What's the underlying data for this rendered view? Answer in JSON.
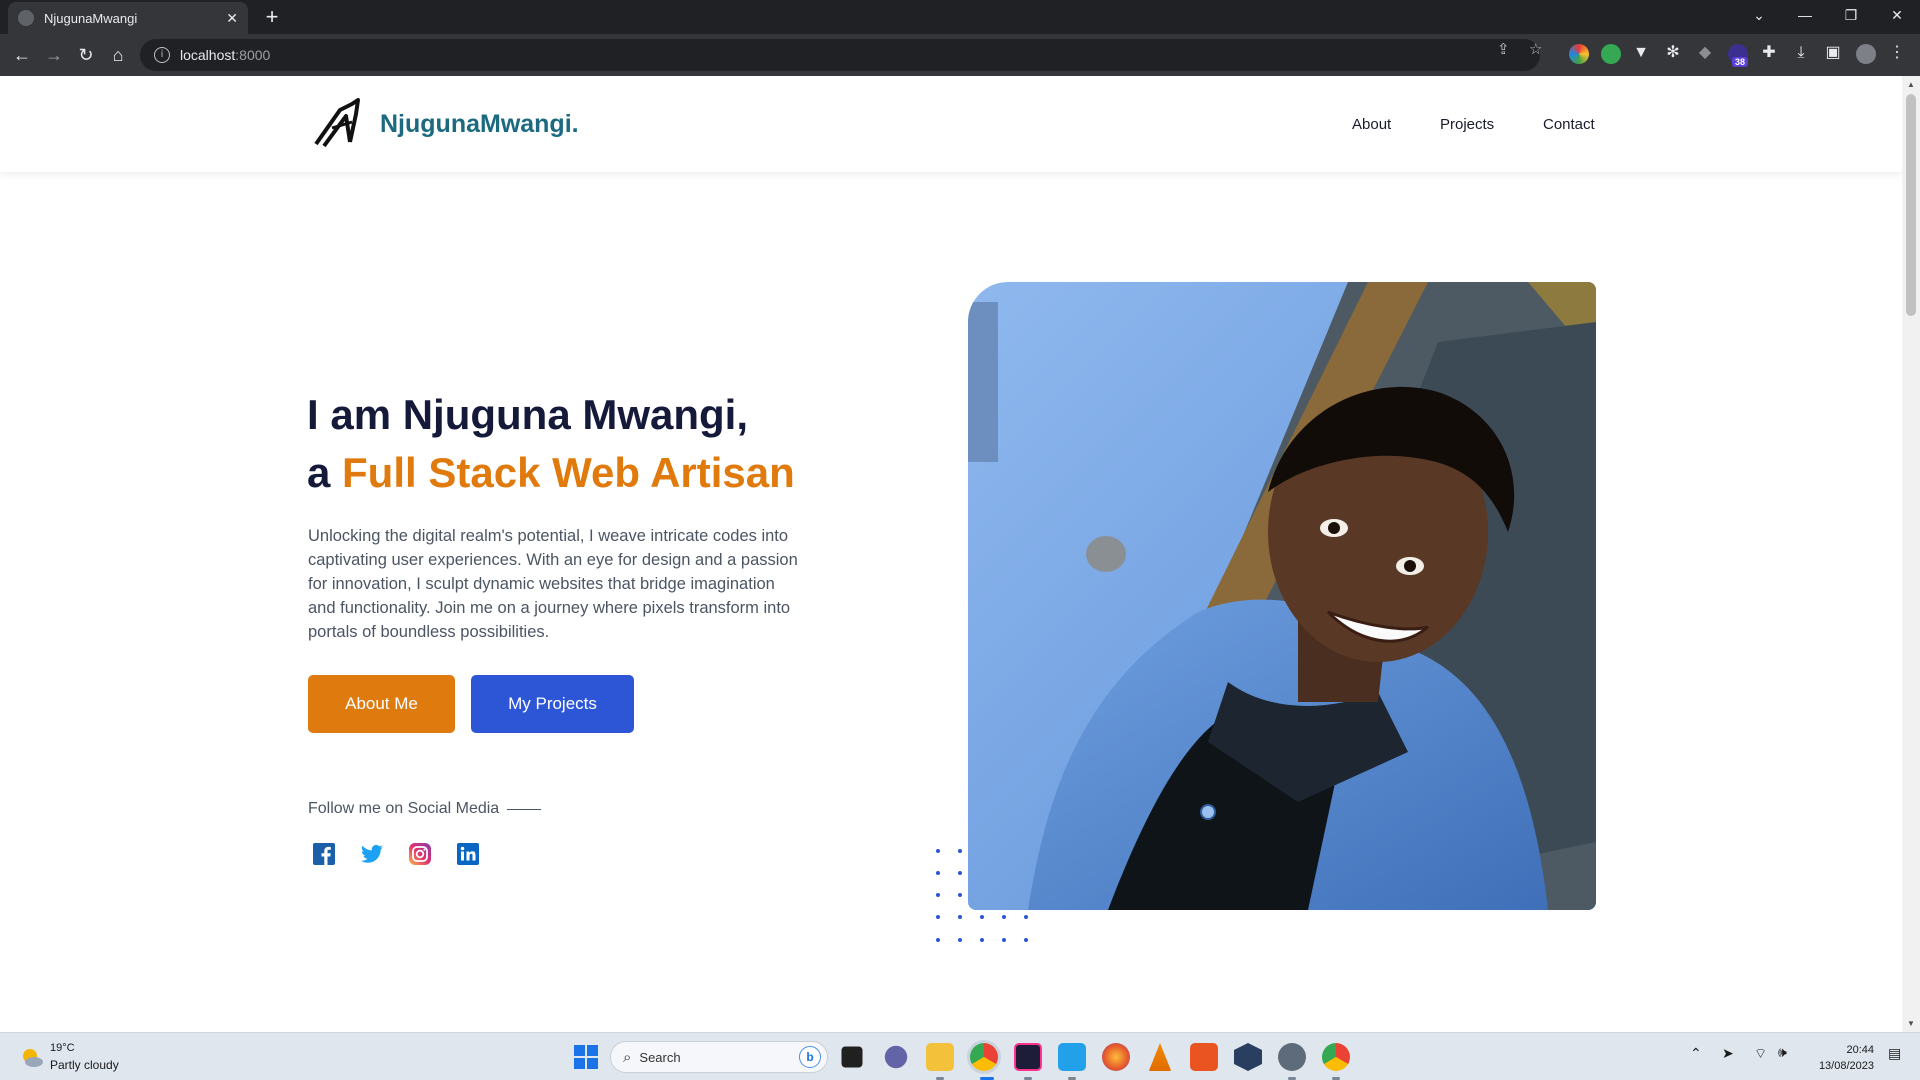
{
  "browser": {
    "tab_title": "NjugunaMwangi",
    "url_host": "localhost",
    "url_port": ":8000",
    "extension_badge": "38"
  },
  "site": {
    "brand": "NjugunaMwangi.",
    "nav": {
      "about": "About",
      "projects": "Projects",
      "contact": "Contact"
    }
  },
  "hero": {
    "title_line1": "I am Njuguna Mwangi,",
    "title_prefix": "a",
    "title_accent": "Full Stack Web Artisan",
    "description": "Unlocking the digital realm's potential, I weave intricate codes into captivating user experiences. With an eye for design and a passion for innovation, I sculpt dynamic websites that bridge imagination and functionality. Join me on a journey where pixels transform into portals of boundless possibilities.",
    "btn_about": "About Me",
    "btn_projects": "My Projects",
    "follow_text": "Follow me on Social Media"
  },
  "colors": {
    "brand": "#1b6a80",
    "accent": "#e07a0c",
    "primary_blue": "#2c56d6",
    "heading": "#15193a"
  },
  "taskbar": {
    "temperature": "19°C",
    "weather": "Partly cloudy",
    "search_placeholder": "Search",
    "time": "20:44",
    "date": "13/08/2023"
  }
}
